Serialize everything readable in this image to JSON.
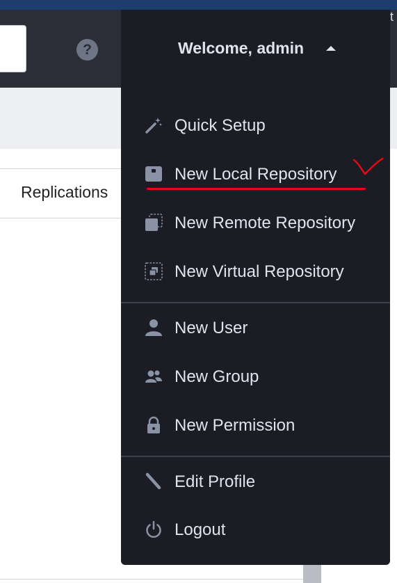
{
  "header": {
    "help_symbol": "?",
    "edge_glyph": "t"
  },
  "tabs": {
    "replications": "Replications"
  },
  "user_menu": {
    "welcome": "Welcome, admin",
    "items": [
      {
        "label": "Quick Setup",
        "icon": "magic-wand-icon"
      },
      {
        "label": "New Local Repository",
        "icon": "local-repo-icon"
      },
      {
        "label": "New Remote Repository",
        "icon": "remote-repo-icon"
      },
      {
        "label": "New Virtual Repository",
        "icon": "virtual-repo-icon"
      },
      {
        "label": "New User",
        "icon": "user-icon"
      },
      {
        "label": "New Group",
        "icon": "group-icon"
      },
      {
        "label": "New Permission",
        "icon": "lock-icon"
      },
      {
        "label": "Edit Profile",
        "icon": "pencil-icon"
      },
      {
        "label": "Logout",
        "icon": "power-icon"
      }
    ]
  },
  "colors": {
    "menu_bg": "#1b1c24",
    "menu_text": "#dfe3ec",
    "icon": "#8a93a6",
    "annotation": "#e50914"
  }
}
